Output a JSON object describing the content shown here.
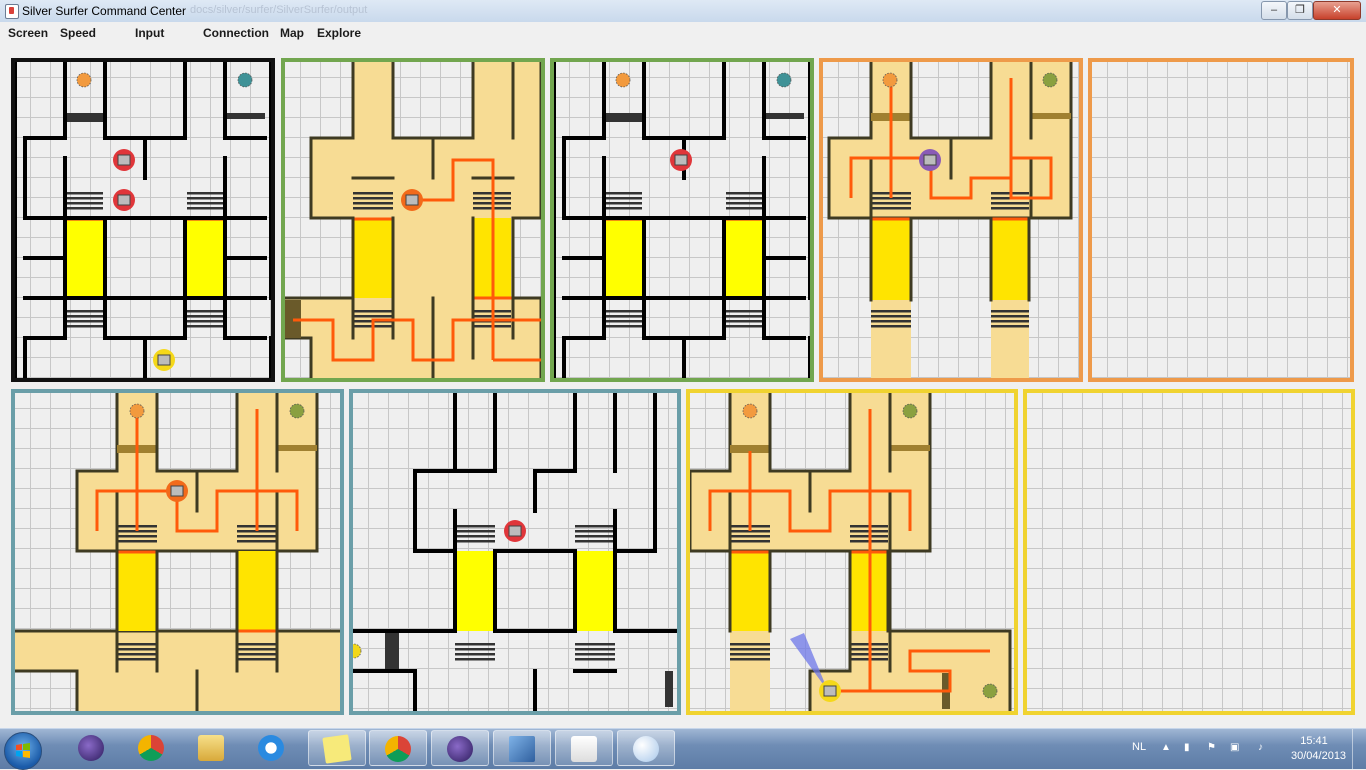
{
  "window": {
    "title": "Silver Surfer Command Center",
    "faded_title": "docs/silver/surfer/SilverSurfer/output"
  },
  "menu": [
    "Screen",
    "Speed",
    "Input",
    "Connection",
    "Map",
    "Explore"
  ],
  "colors": {
    "explored": "#f7dc94",
    "explored_border": "#3e3a22",
    "path": "#ff5a0a",
    "seesaw": "#ffff00",
    "seesaw_explored": "#ffe400",
    "barcode_red": "#e21f1f",
    "wall": "#000000",
    "robot_red": "#e0363a",
    "robot_orange": "#f26a1a",
    "robot_purple": "#8a5bb6",
    "robot_yellow": "#f5d81a",
    "ball_orange": "#f29a3e",
    "ball_teal": "#3f9297",
    "ball_green": "#8aa040",
    "ball_yellow": "#f2d818",
    "sensor_cone": "#6d77e8"
  },
  "panels": [
    {
      "name": "map-panel-overview",
      "border": "#111111",
      "map": "full"
    },
    {
      "name": "map-panel-green-explored",
      "border": "#72a64f",
      "map": "green"
    },
    {
      "name": "map-panel-green-live",
      "border": "#72a64f",
      "map": "green_live"
    },
    {
      "name": "map-panel-orange-explored",
      "border": "#ee9a4a",
      "map": "orange"
    },
    {
      "name": "map-panel-orange-empty",
      "border": "#ee9a4a",
      "map": "empty"
    },
    {
      "name": "map-panel-teal-explored",
      "border": "#6a9ea8",
      "map": "teal"
    },
    {
      "name": "map-panel-teal-live",
      "border": "#6a9ea8",
      "map": "teal_live"
    },
    {
      "name": "map-panel-yellow-explored",
      "border": "#f0d330",
      "map": "yellow"
    },
    {
      "name": "map-panel-yellow-empty",
      "border": "#f0d330",
      "map": "empty"
    }
  ],
  "taskbar": {
    "apps": [
      "start-button",
      "eclipse-pinned",
      "chrome-pinned",
      "explorer-pinned",
      "ie-pinned",
      "sticky-notes",
      "chrome",
      "eclipse",
      "network-tool",
      "java",
      "paint"
    ],
    "language": "NL",
    "time": "15:41",
    "date": "30/04/2013"
  }
}
